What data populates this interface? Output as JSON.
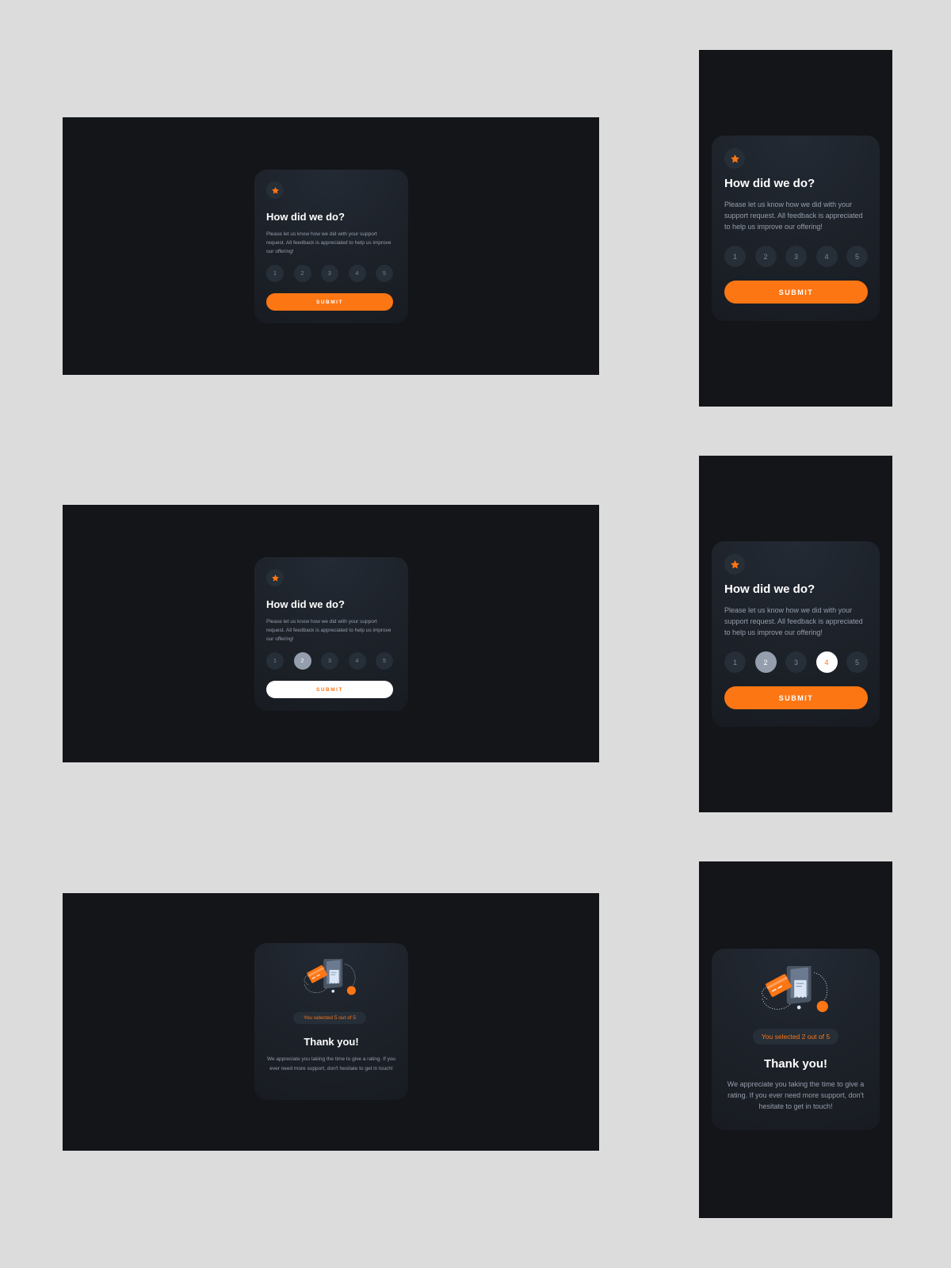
{
  "rating_card": {
    "title": "How did we do?",
    "description": "Please let us know how we did with your support request. All feedback is appreciated to help us improve our offering!",
    "ratings": [
      "1",
      "2",
      "3",
      "4",
      "5"
    ],
    "submit_label": "SUBMIT",
    "star_icon": "star-icon"
  },
  "thank_you_card": {
    "title": "Thank you!",
    "description": "We appreciate you taking the time to give a rating. If you ever need more support, don't hesitate to get in touch!",
    "selected_desktop": "You selected 5 out of 5",
    "selected_mobile": "You selected 2 out of 5",
    "illustration_icon": "payment-illustration-icon"
  },
  "states": {
    "desktop_hover_rating": "2",
    "mobile_selected_ratings": [
      "2",
      "4"
    ]
  },
  "colors": {
    "page_bg": "#dcdcdc",
    "frame_bg": "#131519",
    "card_bg": "#1b1f26",
    "circle_bg": "#262e38",
    "orange": "#fc7614",
    "light_grey": "#959eac",
    "white": "#ffffff"
  }
}
